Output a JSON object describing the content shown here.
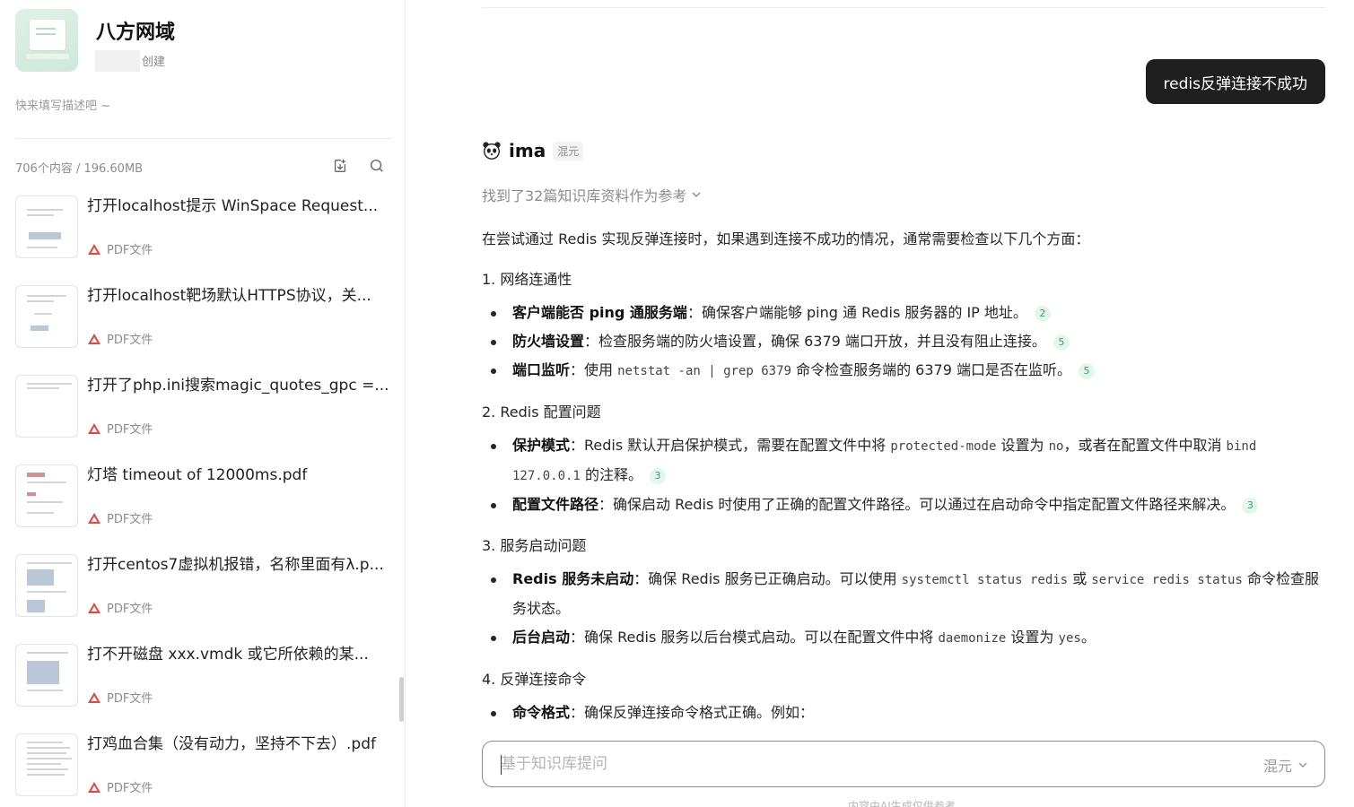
{
  "sidebar": {
    "kb_title": "八方网域",
    "created_label": "创建",
    "description_placeholder": "快来填写描述吧 ~",
    "stats": "706个内容 / 196.60MB",
    "files": [
      {
        "name": "打开localhost提示 WinSpace  Request...",
        "type": "PDF文件"
      },
      {
        "name": "打开localhost靶场默认HTTPS协议，关...",
        "type": "PDF文件"
      },
      {
        "name": "打开了php.ini搜索magic_quotes_gpc =...",
        "type": "PDF文件"
      },
      {
        "name": "灯塔 timeout of 12000ms.pdf",
        "type": "PDF文件"
      },
      {
        "name": "打开centos7虚拟机报错，名称里面有λ.p...",
        "type": "PDF文件"
      },
      {
        "name": "打不开磁盘 xxx.vmdk 或它所依赖的某...",
        "type": "PDF文件"
      },
      {
        "name": "打鸡血合集（没有动力，坚持不下去）.pdf",
        "type": "PDF文件"
      }
    ]
  },
  "chat": {
    "user_message": "redis反弹连接不成功",
    "assistant_name": "ima",
    "model_tag": "混元",
    "references": "找到了32篇知识库资料作为参考",
    "intro": "在尝试通过 Redis 实现反弹连接时，如果遇到连接不成功的情况，通常需要检查以下几个方面：",
    "sections": [
      {
        "title": "1. 网络连通性",
        "items": [
          {
            "bold": "客户端能否 ping 通服务端",
            "text": "：确保客户端能够 ping 通 Redis 服务器的 IP 地址。",
            "cite": "2"
          },
          {
            "bold": "防火墙设置",
            "text": "：检查服务端的防火墙设置，确保 6379 端口开放，并且没有阻止连接。",
            "cite": "5"
          },
          {
            "bold": "端口监听",
            "pre": "：使用 ",
            "code": "netstat -an | grep 6379",
            "post": " 命令检查服务端的 6379 端口是否在监听。",
            "cite": "5"
          }
        ]
      },
      {
        "title": "2. Redis 配置问题",
        "items": [
          {
            "bold": "保护模式",
            "pre": "：Redis 默认开启保护模式，需要在配置文件中将 ",
            "code": "protected-mode",
            "mid": " 设置为 ",
            "code2": "no",
            "mid2": "，或者在配置文件中取消 ",
            "code3": "bind 127.0.0.1",
            "post": " 的注释。",
            "cite": "3"
          },
          {
            "bold": "配置文件路径",
            "text": "：确保启动 Redis 时使用了正确的配置文件路径。可以通过在启动命令中指定配置文件路径来解决。",
            "cite": "3"
          }
        ]
      },
      {
        "title": "3. 服务启动问题",
        "items": [
          {
            "bold": "Redis 服务未启动",
            "pre": "：确保 Redis 服务已正确启动。可以使用 ",
            "code": "systemctl status redis",
            "mid": " 或 ",
            "code2": "service redis status",
            "post": " 命令检查服务状态。"
          },
          {
            "bold": "后台启动",
            "pre": "：确保 Redis 服务以后台模式启动。可以在配置文件中将 ",
            "code": "daemonize",
            "mid": " 设置为 ",
            "code2": "yes",
            "post": "。"
          }
        ]
      },
      {
        "title": "4. 反弹连接命令",
        "items": [
          {
            "bold": "命令格式",
            "text": "：确保反弹连接命令格式正确。例如："
          }
        ]
      }
    ]
  },
  "input": {
    "placeholder": "基于知识库提问",
    "model": "混元"
  },
  "footer_note": "内容由AI生成仅供参考",
  "icons": {
    "sidebar_tools": [
      "add-file-icon",
      "search-icon"
    ],
    "file_type": "pdf-icon",
    "assistant": "panda-icon",
    "expand": "chevron-down-icon"
  }
}
